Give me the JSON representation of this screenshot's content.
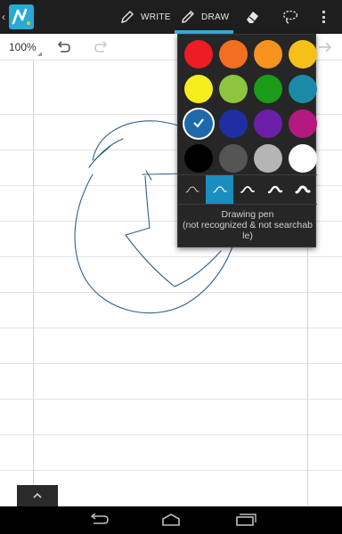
{
  "topbar": {
    "back_glyph": "‹",
    "logo_icon": "nebo-logo-icon",
    "write_label": "WRITE",
    "draw_label": "DRAW",
    "write_icon": "pen-icon",
    "draw_icon": "pencil-icon",
    "eraser_icon": "eraser-icon",
    "lasso_icon": "lasso-icon",
    "overflow_icon": "overflow-menu-icon",
    "accent_color": "#33b5e5"
  },
  "toolbar": {
    "zoom": "100%",
    "undo_icon": "undo-icon",
    "redo_icon": "redo-icon",
    "next_icon": "arrow-right-icon"
  },
  "palette": {
    "colors": [
      "#ee1c25",
      "#f26f21",
      "#f7931e",
      "#f5c018",
      "#f5ed1c",
      "#8cc63f",
      "#1a9b1a",
      "#1b8aa7",
      "#1e6aa9",
      "#1f2fa2",
      "#6a1fa6",
      "#b3197f",
      "#000000",
      "#555555",
      "#b5b5b5",
      "#ffffff"
    ],
    "selected_index": 8,
    "pens": [
      "pen-stroke-1-icon",
      "pen-stroke-2-icon",
      "pen-stroke-3-icon",
      "pen-stroke-4-icon",
      "pen-stroke-5-icon"
    ],
    "selected_pen_index": 1,
    "description_line1": "Drawing pen",
    "description_line2": "(not recognized & not searchab",
    "description_line3": "le)"
  },
  "canvas": {
    "ink_color": "#2c5e8f"
  },
  "navbar": {
    "back_icon": "nav-back-icon",
    "home_icon": "nav-home-icon",
    "recent_icon": "nav-recent-apps-icon"
  }
}
